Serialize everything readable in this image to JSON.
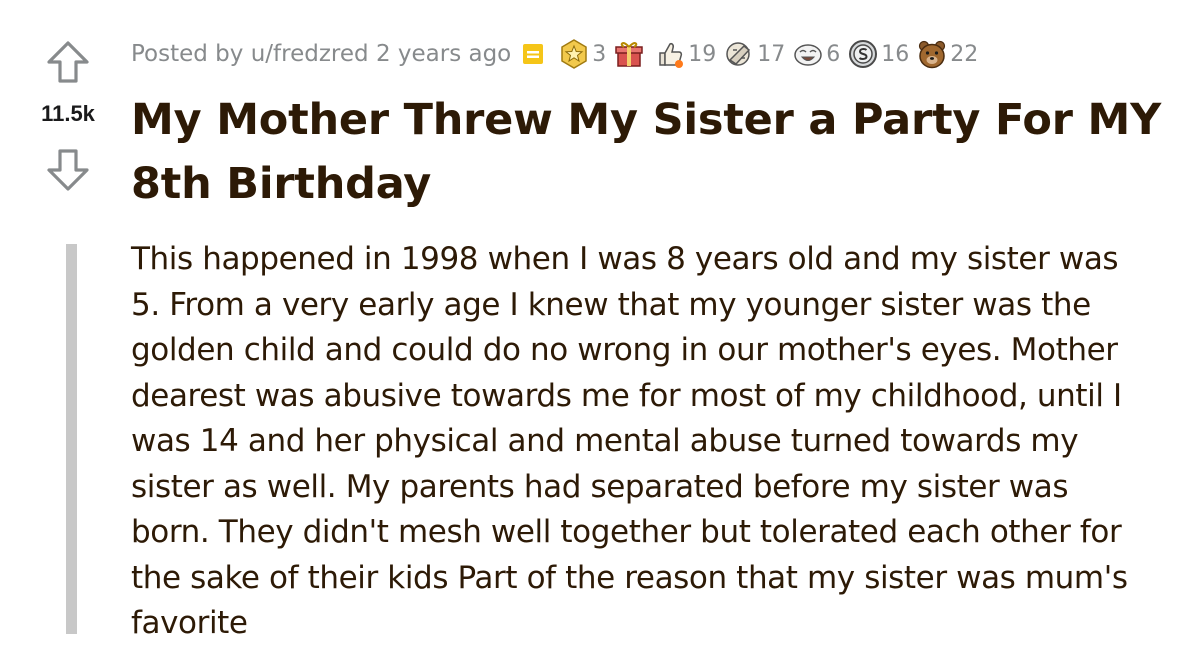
{
  "post": {
    "score": "11.5k",
    "posted_prefix": "Posted by",
    "author": "u/fredzred",
    "age": "2 years ago",
    "title": "My Mother Threw My Sister a Party For MY 8th Birthday",
    "body": "This happened in 1998 when I was 8 years old and my sister was 5. From a very early age I knew that my younger sister was the golden child and could do no wrong in our mother's eyes. Mother dearest was abusive towards me for most of my childhood, until I was 14 and her physical and mental abuse turned towards my sister as well. My parents had separated before my sister was born. They didn't mesh well together but tolerated each other for the sake of their kids Part of the reason that my sister was mum's favorite"
  },
  "awards": [
    {
      "icon": "gold-star-award-icon",
      "count": "3"
    },
    {
      "icon": "gift-box-award-icon",
      "count": ""
    },
    {
      "icon": "thumbs-up-award-icon",
      "count": "19"
    },
    {
      "icon": "facepalm-award-icon",
      "count": "17"
    },
    {
      "icon": "laughing-face-award-icon",
      "count": "6"
    },
    {
      "icon": "silver-coin-award-icon",
      "count": "16"
    },
    {
      "icon": "bear-award-icon",
      "count": "22"
    }
  ],
  "colors": {
    "text": "#2d1a06",
    "meta": "#878a8c",
    "arrow": "#878a8c",
    "quote_bar": "#c8c8c8",
    "badge": "#f5c518"
  }
}
